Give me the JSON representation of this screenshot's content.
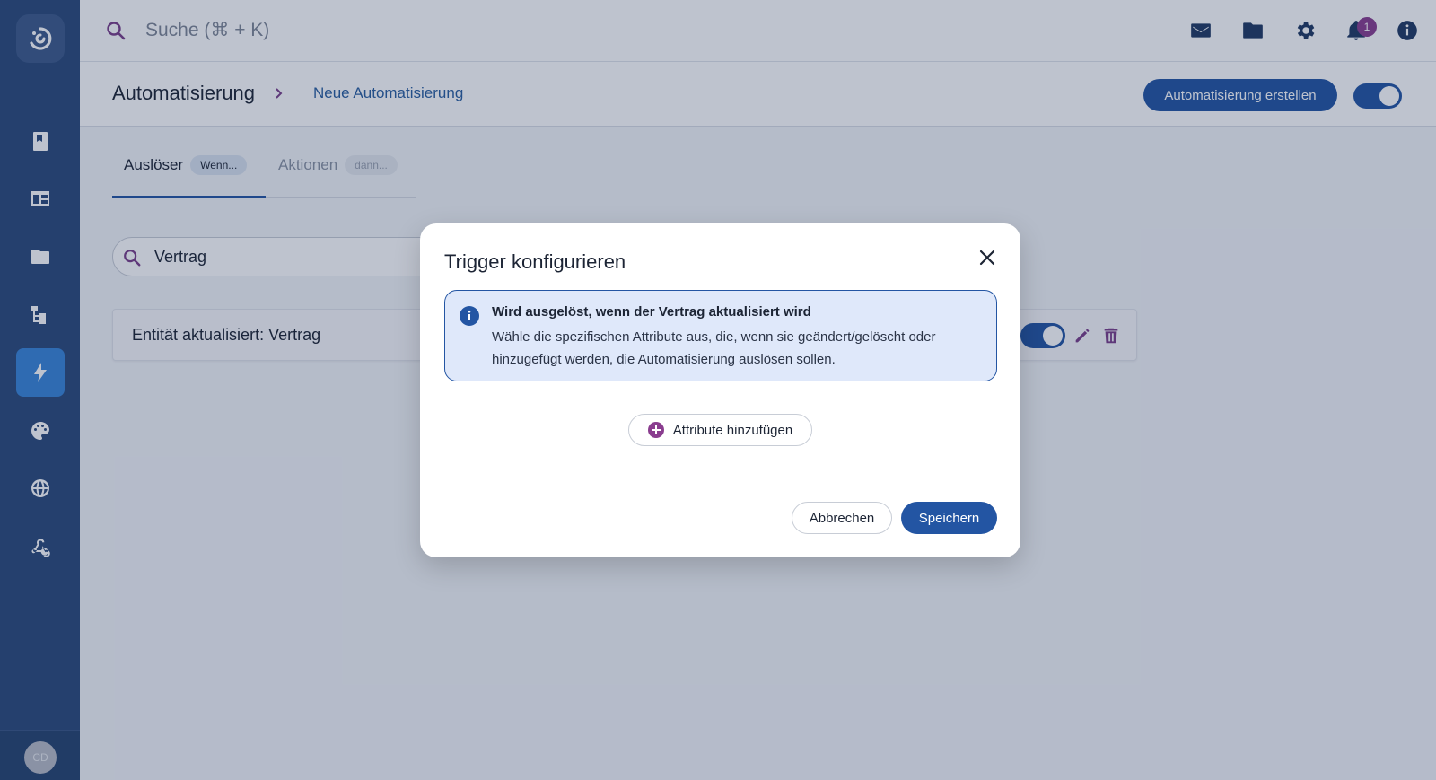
{
  "topbar": {
    "search_placeholder": "Suche (⌘ + K)",
    "icons": [
      "mail-icon",
      "folder-icon",
      "gear-icon",
      "bell-icon",
      "info-icon"
    ],
    "notification_count": "1"
  },
  "sidebar": {
    "items": [
      "bookmark-icon",
      "layout-icon",
      "folder-icon",
      "hierarchy-icon",
      "lightning-icon",
      "palette-icon",
      "globe-icon",
      "webhook-icon"
    ],
    "active_item": "lightning-icon",
    "avatar_initials": "CD"
  },
  "header": {
    "title": "Automatisierung",
    "breadcrumb_current": "Neue Automatisierung",
    "create_button": "Automatisierung erstellen",
    "enabled": true
  },
  "tabs": [
    {
      "label": "Auslöser",
      "pill": "Wenn..."
    },
    {
      "label": "Aktionen",
      "pill": "dann..."
    }
  ],
  "search": {
    "value": "Vertrag"
  },
  "trigger_card": {
    "title": "Entität aktualisiert: Vertrag",
    "enabled": true
  },
  "modal": {
    "title": "Trigger konfigurieren",
    "info_title": "Wird ausgelöst, wenn der Vertrag aktualisiert wird",
    "info_text": "Wähle die spezifischen Attribute aus, die, wenn sie geändert/gelöscht oder hinzugefügt werden, die Automatisierung auslösen sollen.",
    "add_button": "Attribute hinzufügen",
    "cancel_button": "Abbrechen",
    "save_button": "Speichern"
  },
  "colors": {
    "primary": "#2355a3",
    "sidebar": "#2b4a7a",
    "accent_purple": "#8a3d8f",
    "info_background": "#dfe8fa"
  }
}
